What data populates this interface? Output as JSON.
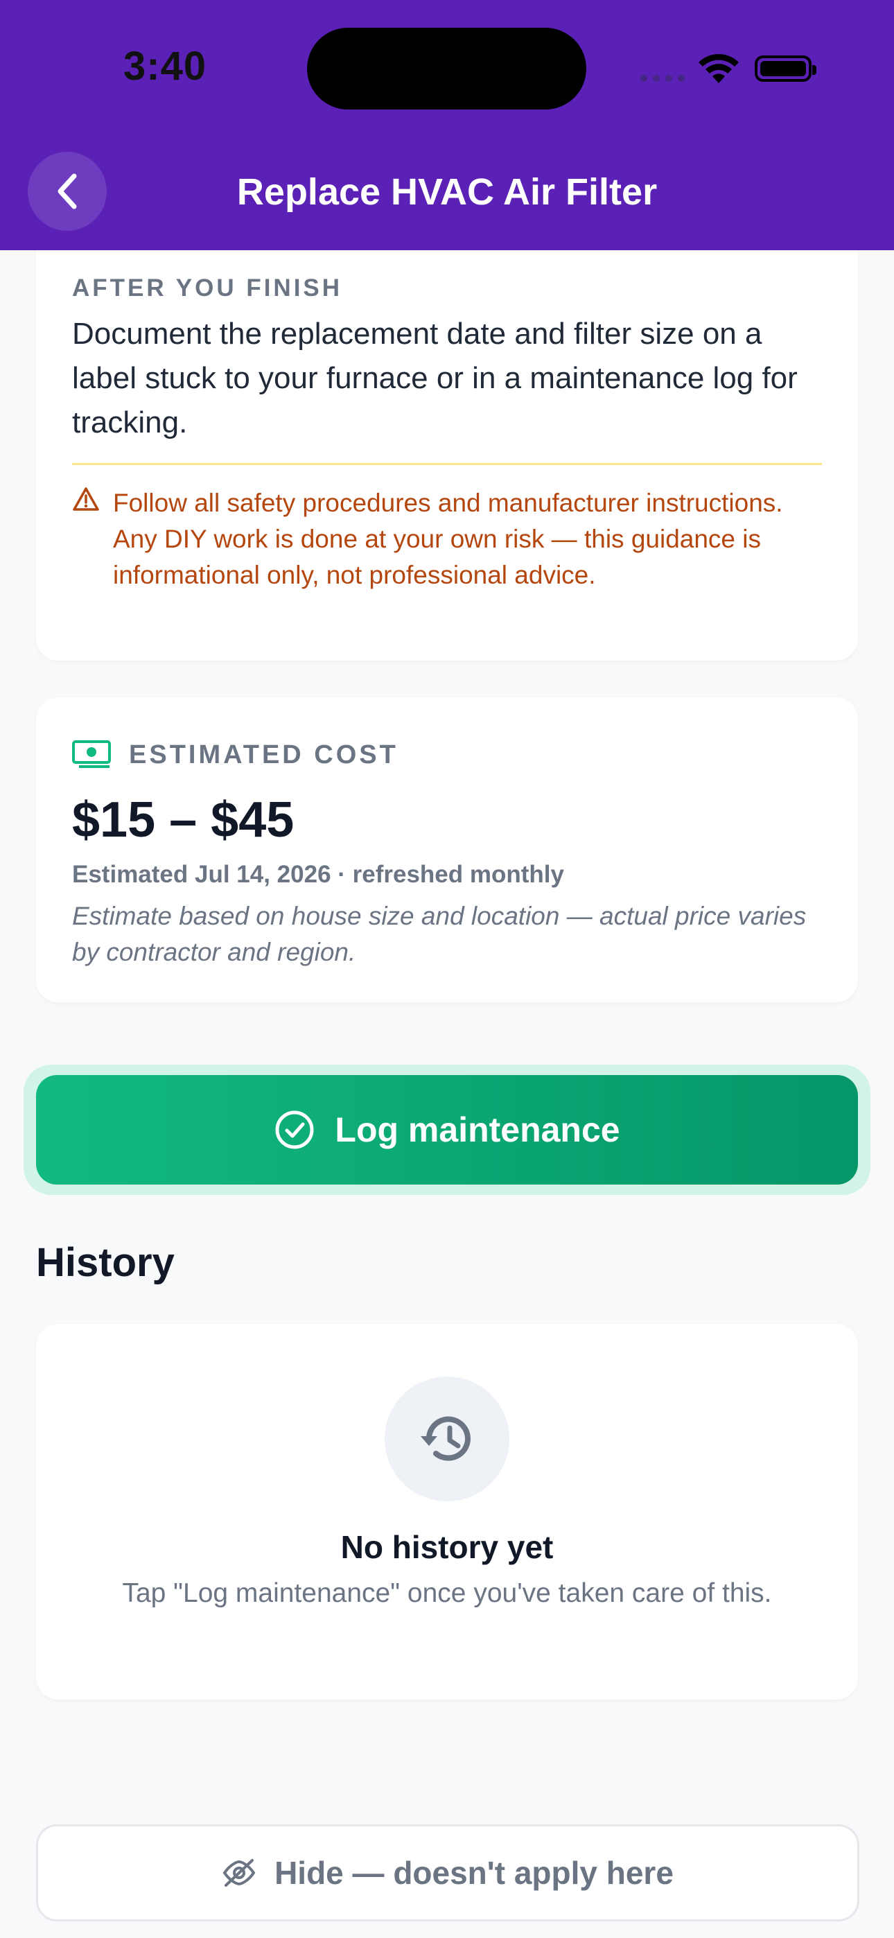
{
  "status_bar": {
    "time": "3:40"
  },
  "header": {
    "title": "Replace HVAC Air Filter",
    "back_icon": "chevron-left-icon"
  },
  "after_finish": {
    "label": "AFTER YOU FINISH",
    "text": "Document the replacement date and filter size on a label stuck to your furnace or in a maintenance log for tracking.",
    "warning": "Follow all safety procedures and manufacturer instructions. Any DIY work is done at your own risk — this guidance is informational only, not professional advice."
  },
  "cost": {
    "label": "ESTIMATED COST",
    "value": "$15 – $45",
    "date": "Estimated Jul 14, 2026 · refreshed monthly",
    "note": "Estimate based on house size and location — actual price varies by contractor and region."
  },
  "log_button": {
    "label": "Log maintenance"
  },
  "history": {
    "title": "History",
    "empty_title": "No history yet",
    "empty_sub": "Tap \"Log maintenance\" once you've taken care of this."
  },
  "hide_button": {
    "label": "Hide — doesn't apply here"
  },
  "colors": {
    "header": "#5b21b6",
    "accent_green": "#10b981",
    "warning": "#b4460e",
    "muted": "#6b7483"
  }
}
